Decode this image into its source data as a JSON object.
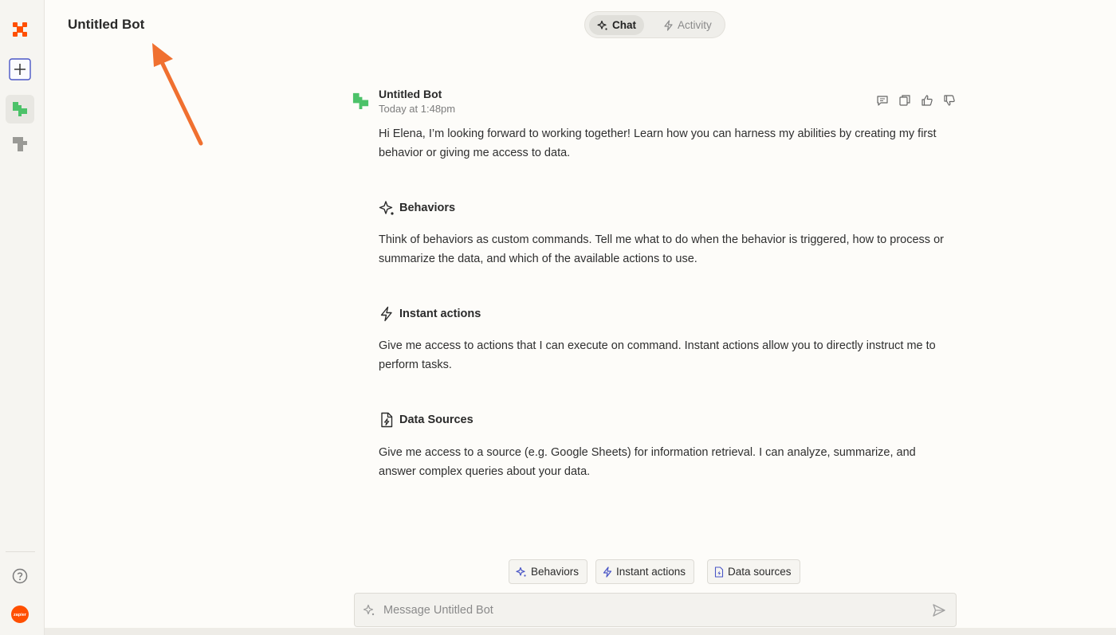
{
  "header": {
    "title": "Untitled Bot",
    "tabs": [
      {
        "label": "Chat",
        "active": true
      },
      {
        "label": "Activity",
        "active": false
      }
    ]
  },
  "sidebar": {
    "items": [
      {
        "icon": "zapier-logo-icon"
      },
      {
        "icon": "add-icon"
      },
      {
        "icon": "bot-puzzle-icon",
        "active": true
      },
      {
        "icon": "bot-template-icon"
      },
      {
        "icon": "help-icon"
      },
      {
        "icon": "account-zapier-icon",
        "label": "zapier"
      }
    ]
  },
  "message": {
    "sender": "Untitled Bot",
    "time": "Today at 1:48pm",
    "intro": "Hi Elena, I’m looking forward to working together! Learn how you can harness my abilities by creating my first behavior or giving me access to data.",
    "sections": [
      {
        "title": "Behaviors",
        "icon": "sparkle-icon",
        "text": "Think of behaviors as custom commands. Tell me what to do when the behavior is triggered, how to process or summarize the data, and which of the available actions to use."
      },
      {
        "title": "Instant actions",
        "icon": "lightning-icon",
        "text": "Give me access to actions that I can execute on command. Instant actions allow you to directly instruct me to perform tasks."
      },
      {
        "title": "Data Sources",
        "icon": "file-icon",
        "text": "Give me access to a source (e.g. Google Sheets) for information retrieval. I can analyze, summarize, and answer complex queries about your data."
      }
    ]
  },
  "chips": [
    {
      "label": "Behaviors"
    },
    {
      "label": "Instant actions"
    },
    {
      "label": "Data sources"
    }
  ],
  "composer": {
    "placeholder": "Message Untitled Bot",
    "value": ""
  },
  "colors": {
    "brand_orange": "#ff4f00",
    "annotation_arrow": "#f07030",
    "bot_green": "#4cc269",
    "chip_icon_blue": "#4a56c6"
  }
}
